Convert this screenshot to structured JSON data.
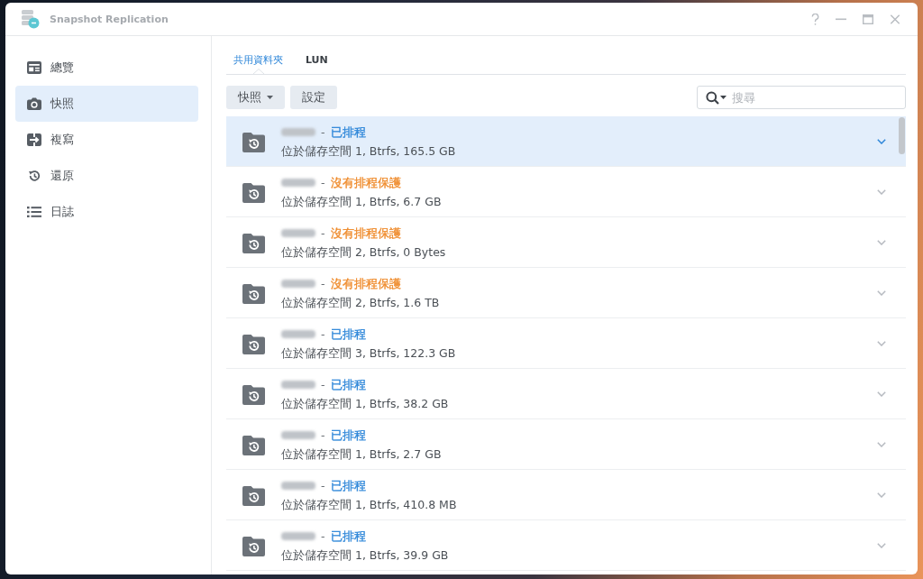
{
  "window": {
    "title": "Snapshot Replication"
  },
  "sidebar": {
    "items": [
      {
        "label": "總覽",
        "selected": false
      },
      {
        "label": "快照",
        "selected": true
      },
      {
        "label": "複寫",
        "selected": false
      },
      {
        "label": "還原",
        "selected": false
      },
      {
        "label": "日誌",
        "selected": false
      }
    ]
  },
  "tabs": [
    {
      "label": "共用資料夾",
      "selected": true
    },
    {
      "label": "LUN",
      "selected": false
    }
  ],
  "toolbar": {
    "buttons": [
      {
        "label": "快照",
        "dropdown": true
      },
      {
        "label": "設定",
        "dropdown": false
      }
    ],
    "search": {
      "placeholder": "搜尋"
    }
  },
  "folders": [
    {
      "name_blurred": true,
      "separator": "-",
      "status": "已排程",
      "color": "#2f87d9",
      "location": "位於儲存空間 1, Btrfs, 165.5 GB",
      "selected": true
    },
    {
      "name_blurred": true,
      "separator": "-",
      "status": "沒有排程保護",
      "color": "#ef8b2c",
      "location": "位於儲存空間 1, Btrfs, 6.7 GB",
      "selected": false
    },
    {
      "name_blurred": true,
      "separator": "-",
      "status": "沒有排程保護",
      "color": "#ef8b2c",
      "location": "位於儲存空間 2, Btrfs, 0 Bytes",
      "selected": false
    },
    {
      "name_blurred": true,
      "separator": "-",
      "status": "沒有排程保護",
      "color": "#ef8b2c",
      "location": "位於儲存空間 2, Btrfs, 1.6 TB",
      "selected": false
    },
    {
      "name_blurred": true,
      "separator": "-",
      "status": "已排程",
      "color": "#2f87d9",
      "location": "位於儲存空間 3, Btrfs, 122.3 GB",
      "selected": false
    },
    {
      "name_blurred": true,
      "separator": "-",
      "status": "已排程",
      "color": "#2f87d9",
      "location": "位於儲存空間 1, Btrfs, 38.2 GB",
      "selected": false
    },
    {
      "name_blurred": true,
      "separator": "-",
      "status": "已排程",
      "color": "#2f87d9",
      "location": "位於儲存空間 1, Btrfs, 2.7 GB",
      "selected": false
    },
    {
      "name_blurred": true,
      "separator": "-",
      "status": "已排程",
      "color": "#2f87d9",
      "location": "位於儲存空間 1, Btrfs, 410.8 MB",
      "selected": false
    },
    {
      "name_blurred": true,
      "separator": "-",
      "status": "已排程",
      "color": "#2f87d9",
      "location": "位於儲存空間 1, Btrfs, 39.9 GB",
      "selected": false
    }
  ]
}
